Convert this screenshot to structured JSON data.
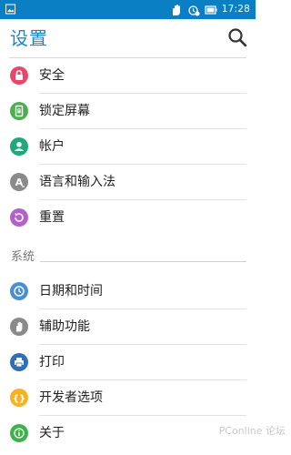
{
  "status_bar": {
    "time": "17:28",
    "bg_color": "#0a7fc4",
    "icons": [
      "image-icon",
      "hand-icon",
      "alarm-icon",
      "battery-icon"
    ]
  },
  "header": {
    "title": "设置",
    "title_color": "#1b87c9",
    "search_icon": "search-icon"
  },
  "personal_items": [
    {
      "label": "安全",
      "icon": "lock-icon",
      "color": "#e8476a"
    },
    {
      "label": "锁定屏幕",
      "icon": "phone-lock-icon",
      "color": "#4caf50"
    },
    {
      "label": "帐户",
      "icon": "person-icon",
      "color": "#1fa97b"
    },
    {
      "label": "语言和输入法",
      "icon": "language-icon",
      "color": "#8a8a8a"
    },
    {
      "label": "重置",
      "icon": "reset-icon",
      "color": "#b462c9"
    }
  ],
  "system_section": {
    "title": "系统",
    "items": [
      {
        "label": "日期和时间",
        "icon": "clock-icon",
        "color": "#4a8fd6"
      },
      {
        "label": "辅助功能",
        "icon": "hand-icon",
        "color": "#8a8a8a"
      },
      {
        "label": "打印",
        "icon": "printer-icon",
        "color": "#2d6fb8"
      },
      {
        "label": "开发者选项",
        "icon": "code-braces-icon",
        "color": "#f5b323"
      },
      {
        "label": "关于",
        "icon": "info-icon",
        "color": "#3fb24a"
      }
    ]
  },
  "watermark": "PConline 论坛"
}
